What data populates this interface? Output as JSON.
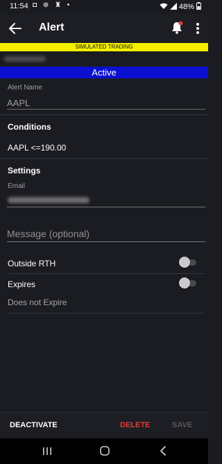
{
  "status": {
    "time": "11:54",
    "battery": "48%",
    "icons": "◘ ⊕ ♜ •"
  },
  "header": {
    "title": "Alert"
  },
  "banners": {
    "simulated": "SIMULATED TRADING",
    "state": "Active"
  },
  "form": {
    "alert_name_label": "Alert Name",
    "alert_name_value": "AAPL",
    "conditions_header": "Conditions",
    "condition_text": "AAPL <=190.00",
    "settings_header": "Settings",
    "email_label": "Email",
    "message_placeholder": "Message (optional)",
    "outside_rth_label": "Outside RTH",
    "outside_rth_on": false,
    "expires_label": "Expires",
    "expires_on": false,
    "expires_sub": "Does not Expire"
  },
  "actions": {
    "deactivate": "DEACTIVATE",
    "delete": "DELETE",
    "save": "SAVE"
  },
  "colors": {
    "sim_banner": "#f4ef00",
    "active_banner": "#0a0fd0",
    "delete": "#e53935",
    "notification_dot": "#e53935",
    "background": "#1b1c21"
  },
  "icons": {
    "back": "arrow-left-icon",
    "bell": "bell-icon",
    "more": "more-vert-icon",
    "wifi": "wifi-icon",
    "signal": "signal-icon",
    "battery": "battery-icon",
    "nav_recents": "recents-icon",
    "nav_home": "home-icon",
    "nav_back": "back-chevron-icon"
  }
}
